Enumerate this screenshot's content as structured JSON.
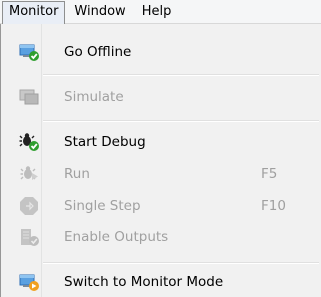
{
  "menubar": {
    "items": [
      {
        "label": "Monitor"
      },
      {
        "label": "Window"
      },
      {
        "label": "Help"
      }
    ]
  },
  "menu": {
    "go_offline": {
      "label": "Go Offline",
      "icon": "go-offline-icon",
      "enabled": true
    },
    "simulate": {
      "label": "Simulate",
      "icon": "simulate-icon",
      "enabled": false
    },
    "start_debug": {
      "label": "Start Debug",
      "icon": "start-debug-icon",
      "enabled": true
    },
    "run": {
      "label": "Run",
      "shortcut": "F5",
      "icon": "run-icon",
      "enabled": false
    },
    "single_step": {
      "label": "Single Step",
      "shortcut": "F10",
      "icon": "single-step-icon",
      "enabled": false
    },
    "enable_outputs": {
      "label": "Enable Outputs",
      "icon": "enable-outputs-icon",
      "enabled": false
    },
    "switch_monitor": {
      "label": "Switch to Monitor Mode",
      "icon": "switch-monitor-mode-icon",
      "enabled": true
    }
  },
  "colors": {
    "check_green": "#2e9e2e",
    "arrow_orange": "#f0a020",
    "monitor_blue": "#3a7bd5",
    "disabled_gray": "#a0a0a0"
  }
}
